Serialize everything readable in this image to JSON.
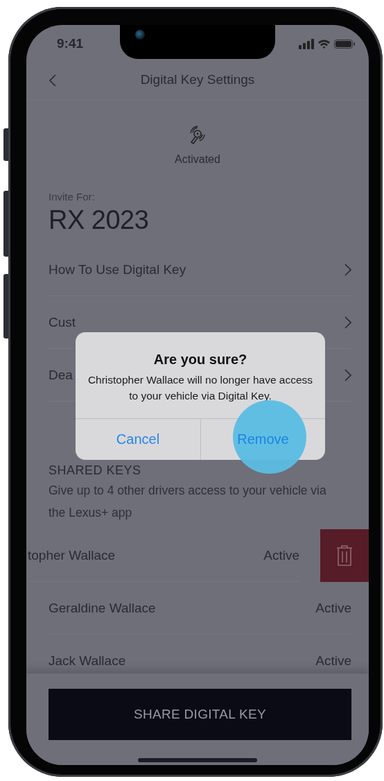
{
  "status_bar": {
    "time": "9:41"
  },
  "header": {
    "title": "Digital Key Settings"
  },
  "key_status": {
    "label": "Activated"
  },
  "invite": {
    "label": "Invite For:",
    "vehicle": "RX 2023"
  },
  "menu_items": [
    {
      "label": "How To Use Digital Key"
    },
    {
      "label": "Cust"
    },
    {
      "label": "Dea"
    }
  ],
  "shared_keys": {
    "heading": "SHARED KEYS",
    "description": "Give up to 4 other drivers access to your vehicle via the Lexus+ app",
    "drivers": [
      {
        "name": "topher Wallace",
        "status": "Active",
        "swiped": true
      },
      {
        "name": "Geraldine Wallace",
        "status": "Active",
        "swiped": false
      },
      {
        "name": "Jack Wallace",
        "status": "Active",
        "swiped": false
      }
    ]
  },
  "share_button": {
    "label": "SHARE DIGITAL KEY"
  },
  "dialog": {
    "title": "Are you sure?",
    "message": "Christopher Wallace will no longer have access to your vehicle via Digital Key.",
    "buttons": [
      {
        "label": "Cancel",
        "selected": false
      },
      {
        "label": "Remove",
        "selected": true
      }
    ]
  }
}
